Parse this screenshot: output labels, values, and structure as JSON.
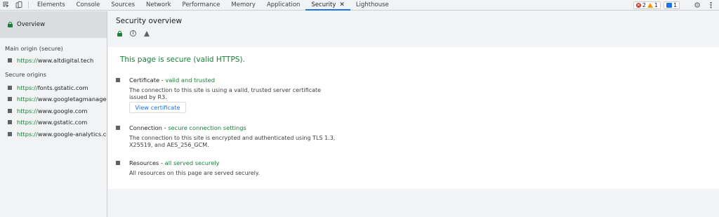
{
  "toolbar": {
    "tabs": [
      "Elements",
      "Console",
      "Sources",
      "Network",
      "Performance",
      "Memory",
      "Application",
      "Security",
      "Lighthouse"
    ],
    "active_tab": "Security",
    "errors": "2",
    "warnings": "1",
    "messages": "1"
  },
  "sidebar": {
    "overview_label": "Overview",
    "main_origin_heading": "Main origin (secure)",
    "main_origin": {
      "scheme": "https://",
      "host": "www.altdigital.tech"
    },
    "secure_origins_heading": "Secure origins",
    "secure_origins": [
      {
        "scheme": "https://",
        "host": "fonts.gstatic.com"
      },
      {
        "scheme": "https://",
        "host": "www.googletagmanager.com"
      },
      {
        "scheme": "https://",
        "host": "www.google.com"
      },
      {
        "scheme": "https://",
        "host": "www.gstatic.com"
      },
      {
        "scheme": "https://",
        "host": "www.google-analytics.com"
      }
    ]
  },
  "main": {
    "title": "Security overview",
    "summary": "This page is secure (valid HTTPS).",
    "certificate": {
      "label": "Certificate - ",
      "status": "valid and trusted",
      "text": "The connection to this site is using a valid, trusted server certificate issued by R3.",
      "button": "View certificate"
    },
    "connection": {
      "label": "Connection - ",
      "status": "secure connection settings",
      "text": "The connection to this site is encrypted and authenticated using TLS 1.3, X25519, and AES_256_GCM."
    },
    "resources": {
      "label": "Resources - ",
      "status": "all served securely",
      "text": "All resources on this page are served securely."
    }
  },
  "colors": {
    "secure_green": "#188038",
    "accent_blue": "#1a73e8",
    "error_red": "#d93025",
    "warning_orange": "#f29900"
  }
}
